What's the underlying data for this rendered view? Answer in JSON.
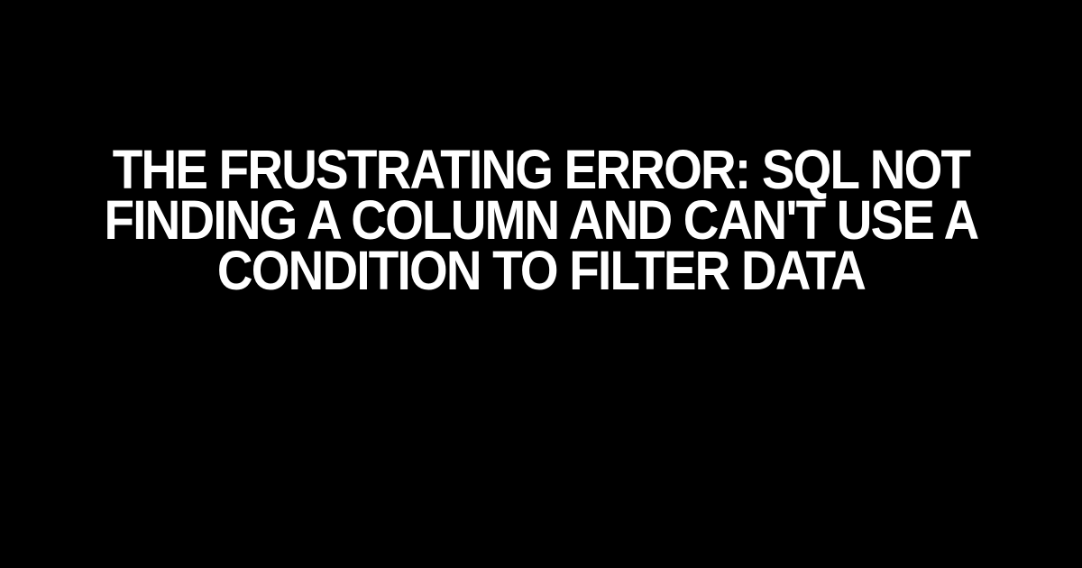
{
  "headline": "The Frustrating Error: SQL Not Finding a Column and Can't Use a Condition to Filter Data"
}
